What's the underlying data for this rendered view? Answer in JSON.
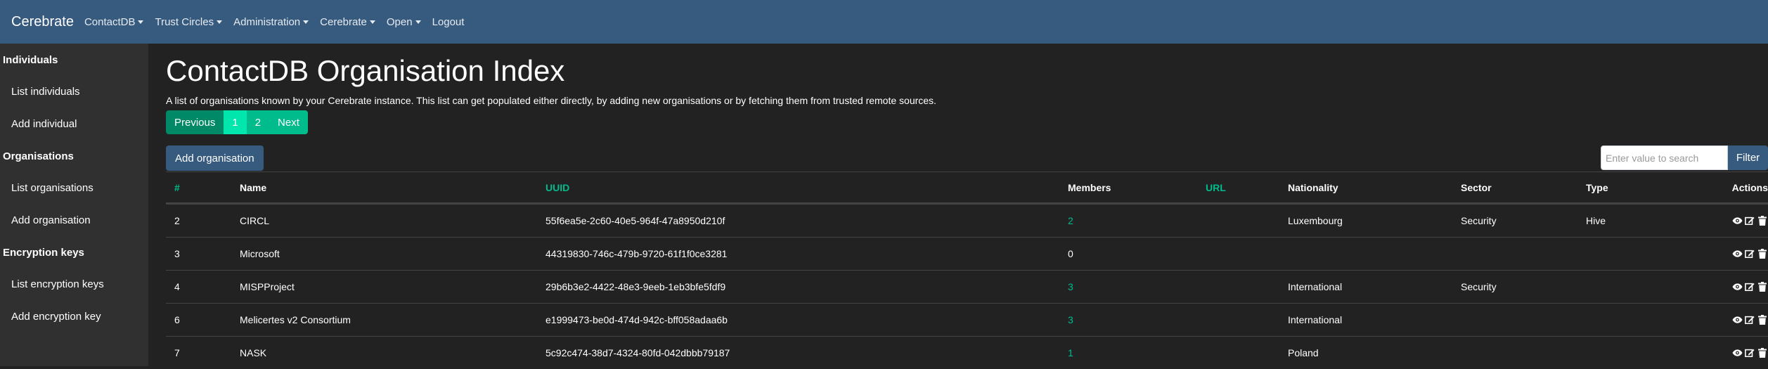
{
  "navbar": {
    "brand": "Cerebrate",
    "items": [
      {
        "label": "ContactDB",
        "dropdown": true
      },
      {
        "label": "Trust Circles",
        "dropdown": true
      },
      {
        "label": "Administration",
        "dropdown": true
      },
      {
        "label": "Cerebrate",
        "dropdown": true
      },
      {
        "label": "Open",
        "dropdown": true
      },
      {
        "label": "Logout",
        "dropdown": false
      }
    ]
  },
  "sidebar": {
    "sections": [
      {
        "title": "Individuals",
        "links": [
          "List individuals",
          "Add individual"
        ]
      },
      {
        "title": "Organisations",
        "links": [
          "List organisations",
          "Add organisation"
        ]
      },
      {
        "title": "Encryption keys",
        "links": [
          "List encryption keys",
          "Add encryption key"
        ]
      }
    ]
  },
  "main": {
    "title": "ContactDB Organisation Index",
    "description": "A list of organisations known by your Cerebrate instance. This list can get populated either directly, by adding new organisations or by fetching them from trusted remote sources.",
    "pagination": {
      "prev": "Previous",
      "pages": [
        "1",
        "2"
      ],
      "active": "1",
      "next": "Next"
    },
    "add_button": "Add organisation",
    "search": {
      "placeholder": "Enter value to search",
      "filter_label": "Filter"
    }
  },
  "table": {
    "headers": {
      "id": "#",
      "name": "Name",
      "uuid": "UUID",
      "members": "Members",
      "url": "URL",
      "nationality": "Nationality",
      "sector": "Sector",
      "type": "Type",
      "actions": "Actions"
    },
    "rows": [
      {
        "id": "2",
        "name": "CIRCL",
        "uuid": "55f6ea5e-2c60-40e5-964f-47a8950d210f",
        "members": "2",
        "url": "",
        "nationality": "Luxembourg",
        "sector": "Security",
        "type": "Hive"
      },
      {
        "id": "3",
        "name": "Microsoft",
        "uuid": "44319830-746c-479b-9720-61f1f0ce3281",
        "members": "0",
        "url": "",
        "nationality": "",
        "sector": "",
        "type": ""
      },
      {
        "id": "4",
        "name": "MISPProject",
        "uuid": "29b6b3e2-4422-48e3-9eeb-1eb3bfe5fdf9",
        "members": "3",
        "url": "",
        "nationality": "International",
        "sector": "Security",
        "type": ""
      },
      {
        "id": "6",
        "name": "Melicertes v2 Consortium",
        "uuid": "e1999473-be0d-474d-942c-bff058adaa6b",
        "members": "3",
        "url": "",
        "nationality": "International",
        "sector": "",
        "type": ""
      },
      {
        "id": "7",
        "name": "NASK",
        "uuid": "5c92c474-38d7-4324-80fd-042dbbb79187",
        "members": "1",
        "url": "",
        "nationality": "Poland",
        "sector": "",
        "type": ""
      }
    ],
    "action_icons": [
      "eye-icon",
      "edit-icon",
      "trash-icon"
    ]
  },
  "colors": {
    "navbar": "#375a7f",
    "background": "#222222",
    "sidebar": "#303030",
    "accent_green": "#00bc8c"
  }
}
